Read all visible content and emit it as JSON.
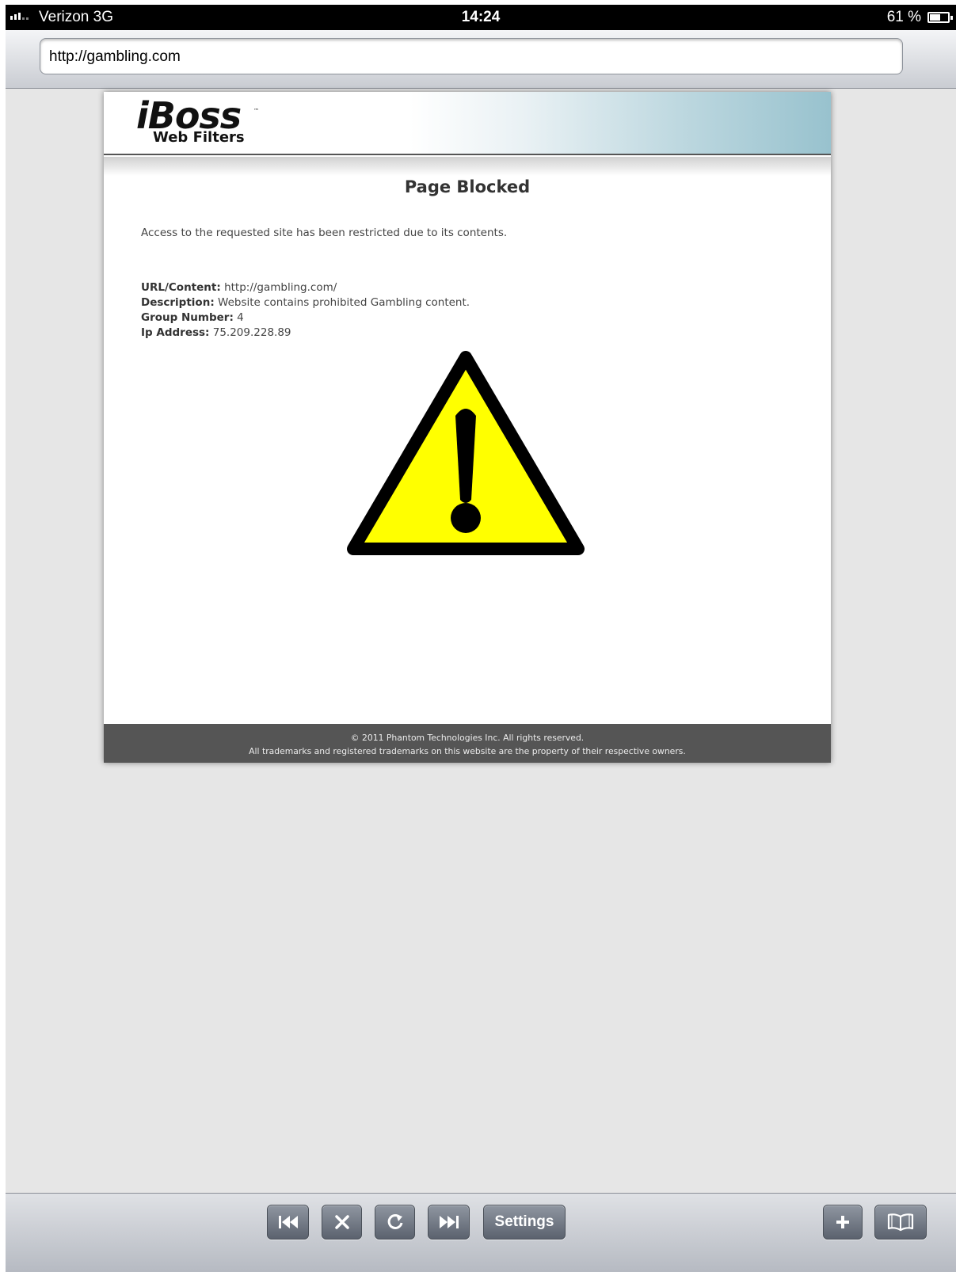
{
  "status_bar": {
    "carrier": "Verizon  3G",
    "time": "14:24",
    "battery": "61 %",
    "battery_level": 0.61
  },
  "address_bar": {
    "url": "http://gambling.com"
  },
  "blocked_page": {
    "logo": {
      "main": "iBoss",
      "sub": "Web Filters",
      "trademark": "™"
    },
    "title": "Page Blocked",
    "message": "Access to the requested site has been restricted due to its contents.",
    "details": [
      {
        "label": "URL/Content:",
        "value": "http://gambling.com/"
      },
      {
        "label": "Description:",
        "value": "Website contains prohibited Gambling content."
      },
      {
        "label": "Group Number:",
        "value": "4"
      },
      {
        "label": "Ip Address:",
        "value": "75.209.228.89"
      }
    ],
    "warning_icon": "warning-triangle-icon",
    "colors": {
      "warning_fill": "#ffff00",
      "footer_bg": "#555555",
      "banner_accent": "#98c2ce"
    },
    "footer": {
      "line1": "© 2011 Phantom Technologies Inc. All rights reserved.",
      "line2": "All trademarks and registered trademarks on this website are the property of their respective owners."
    }
  },
  "toolbar": {
    "back_icon": "skip-back-icon",
    "stop_icon": "close-icon",
    "reload_icon": "reload-icon",
    "forward_icon": "skip-forward-icon",
    "settings_label": "Settings",
    "add_icon": "plus-icon",
    "bookmarks_icon": "book-icon"
  }
}
